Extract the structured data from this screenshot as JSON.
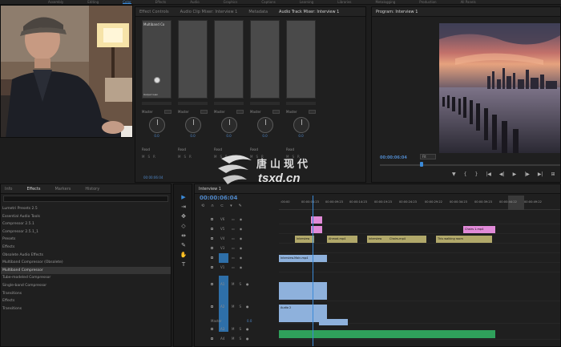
{
  "menu": [
    "Assembly",
    "Editing",
    "Color",
    "Effects",
    "Audio",
    "Graphics",
    "Captions",
    "Learning",
    "Libraries",
    "Metalogging",
    "Production",
    "All Panels"
  ],
  "mixer": {
    "tabs": [
      "Effect Controls",
      "Audio Clip Mixer: Interview 1",
      "Metadata",
      "Audio Track Mixer: Interview 1"
    ],
    "tracks": [
      {
        "fx": "Multiband Co",
        "sub": "Output Gain",
        "send": "Master",
        "knob_val": "0.0",
        "auto": "Read"
      },
      {
        "fx": "",
        "sub": "",
        "send": "Master",
        "knob_val": "0.0",
        "auto": "Read"
      },
      {
        "fx": "",
        "sub": "",
        "send": "Master",
        "knob_val": "0.0",
        "auto": "Read"
      },
      {
        "fx": "",
        "sub": "",
        "send": "Master",
        "knob_val": "0.0",
        "auto": "Read"
      },
      {
        "fx": "",
        "sub": "",
        "send": "Master",
        "knob_val": "0.0",
        "auto": "Read"
      }
    ],
    "msr": [
      "M",
      "S",
      "R"
    ],
    "time": "00:00:06:04"
  },
  "program": {
    "tab": "Program: Interview 1",
    "timecode": "00:00:06:04",
    "fit": "Fit",
    "controls": [
      "▼",
      "{",
      "}",
      "|◀",
      "◀|",
      "▶",
      "|▶",
      "▶|",
      "⊞"
    ]
  },
  "effects": {
    "tabs": [
      "Info",
      "Effects",
      "Markers",
      "History"
    ],
    "search": "",
    "items": [
      "Lumetri Presets 2.5",
      "Essential Audio Tools",
      "Compressor 2.5.1",
      "Compressor 2.5.1_1",
      "Presets",
      "Effects",
      "Obsolete Audio Effects",
      "Multiband Compressor (Obsolete)",
      "Multiband Compressor",
      "Tube-modeled Compressor",
      "Single-band Compressor",
      "Transitions",
      "Effects",
      "Transitions"
    ],
    "selected_index": 8
  },
  "tools": [
    "▶",
    "⇥",
    "✥",
    "◇",
    "⇹",
    "✎",
    "✋",
    "T"
  ],
  "timeline": {
    "tab": "Interview 1",
    "timecode": "00:00:06:04",
    "ticks": [
      ":00:00",
      "00:00:04:23",
      "00:00:09:23",
      "00:00:14:23",
      "00:00:19:23",
      "00:00:24:23",
      "00:00:29:22",
      "00:00:34:23",
      "00:00:39:23",
      "00:00:44:22",
      "00:00:49:22"
    ],
    "video_tracks": [
      "V6",
      "V5",
      "V4",
      "V3",
      "V2",
      "V1"
    ],
    "audio_tracks": [
      "A1",
      "A2",
      "A3",
      "A4"
    ],
    "clips": {
      "v4": [
        "Interview",
        "Ahmad.mp4",
        "Interview",
        "Chairs.mp4",
        "This walking room"
      ],
      "v3_right": "Chairs 1.mp4",
      "v1": "Interview.Main.mp4",
      "a2": "Audio 2"
    },
    "master_label": "Master",
    "master_val": "0.0"
  },
  "watermark": {
    "cn": "唐山现代",
    "url": "tsxd.cn"
  },
  "colors": {
    "accent": "#3b8ad8",
    "pink_clip": "#e18ad8",
    "yellow_clip": "#b1a86a",
    "blue_clip": "#8eb1dc",
    "green_clip": "#2fa05b"
  }
}
